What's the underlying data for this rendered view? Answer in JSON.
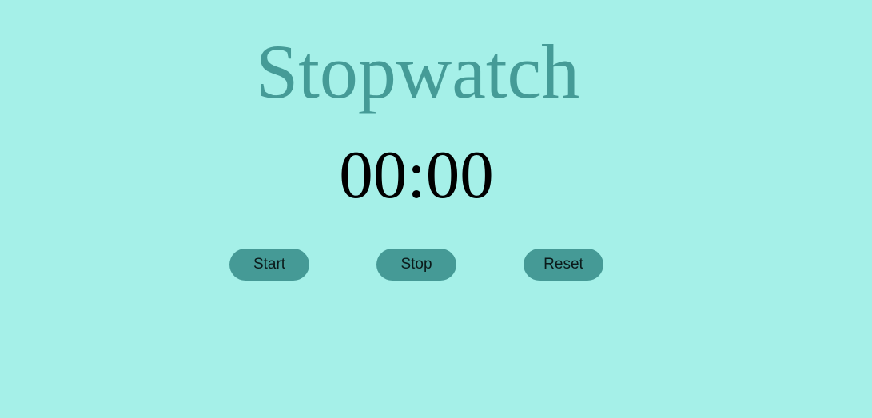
{
  "app": {
    "title": "Stopwatch"
  },
  "display": {
    "time": "00:00"
  },
  "controls": {
    "start_label": "Start",
    "stop_label": "Stop",
    "reset_label": "Reset"
  },
  "colors": {
    "background": "#a5f0e8",
    "title": "#459b97",
    "button": "#459a96",
    "time_text": "#000000"
  }
}
